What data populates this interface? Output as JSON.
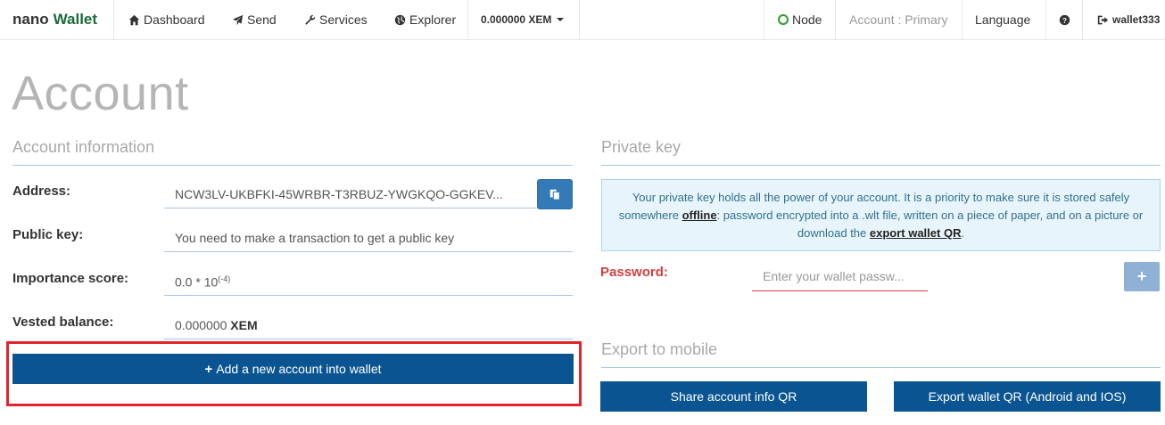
{
  "navbar": {
    "brand_a": "nano",
    "brand_b": "Wallet",
    "dashboard": "Dashboard",
    "send": "Send",
    "services": "Services",
    "explorer": "Explorer",
    "balance": "0.000000 XEM",
    "node": "Node",
    "account": "Account : Primary",
    "language": "Language",
    "user": "wallet333"
  },
  "page": {
    "title": "Account"
  },
  "account_info": {
    "heading": "Account information",
    "address_label": "Address:",
    "address_value": "NCW3LV-UKBFKI-45WRBR-T3RBUZ-YWGKQO-GGKEV...",
    "public_key_label": "Public key:",
    "public_key_value": "You need to make a transaction to get a public key",
    "importance_label": "Importance score:",
    "importance_base": "0.0 * 10",
    "importance_exp": "(-4)",
    "vested_label": "Vested balance:",
    "vested_amount": "0.000000",
    "vested_unit": "XEM",
    "add_account_button": "Add a new account into wallet"
  },
  "private_key": {
    "heading": "Private key",
    "info_text_1": "Your private key holds all the power of your account. It is a priority to make sure it is stored safely somewhere ",
    "info_bold_1": "offline",
    "info_text_2": ": password encrypted into a .wlt file, written on a piece of paper, and on a picture or download the ",
    "info_bold_2": "export wallet QR",
    "info_text_3": ".",
    "password_label": "Password:",
    "password_placeholder": "Enter your wallet passw..."
  },
  "export_mobile": {
    "heading": "Export to mobile",
    "share_button": "Share account info QR",
    "export_button": "Export wallet QR (Android and IOS)"
  },
  "colors": {
    "primary_button": "#0a5591",
    "highlight": "#e3232b",
    "brand_green": "#1b6b3a",
    "danger": "#d33f3f"
  }
}
